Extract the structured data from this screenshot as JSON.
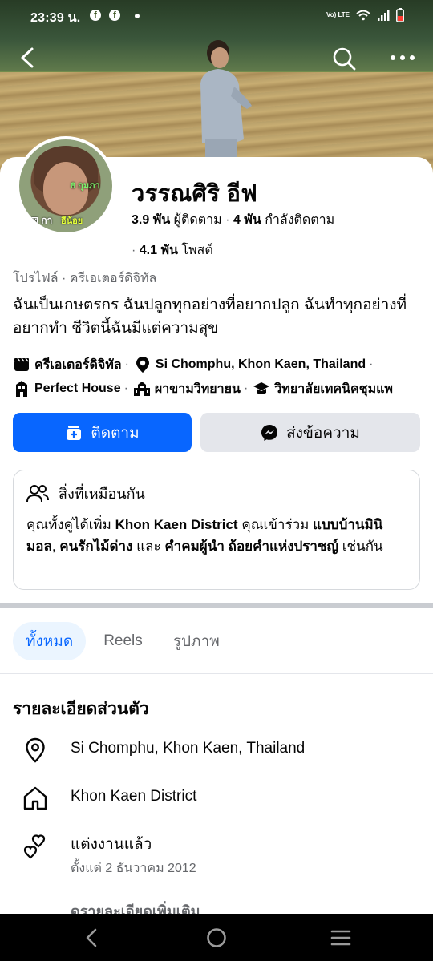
{
  "status_bar": {
    "time": "23:39 น.",
    "network": "Vo) LTE"
  },
  "profile": {
    "name": "วรรณศิริ อีฟ",
    "followers_count": "3.9 พัน",
    "followers_label": "ผู้ติดตาม",
    "following_count": "4 พัน",
    "following_label": "กำลังติดตาม",
    "posts_count": "4.1 พัน",
    "posts_label": "โพสต์",
    "category": "โปรไฟล์ · ครีเอเตอร์ดิจิทัล",
    "bio": "ฉันเป็นเกษตรกร ฉันปลูกทุกอย่างที่อยากปลูก ฉันทำทุกอย่างที่อยากทำ ชีวิตนี้ฉันมีแต่ความสุข",
    "avatar_overlay": {
      "top": "8 กุมภา",
      "bottom_left": "⊠ กา",
      "bottom_right": "อีน้อย"
    }
  },
  "details": {
    "creator": "ครีเอเตอร์ดิจิทัล",
    "location": "Si Chomphu, Khon Kaen, Thailand",
    "workplace": "Perfect House",
    "college": "ผาขามวิทยายน",
    "school": "วิทยาลัยเทคนิคชุมแพ"
  },
  "buttons": {
    "follow": "ติดตาม",
    "message": "ส่งข้อความ"
  },
  "in_common": {
    "title": "สิ่งที่เหมือนกัน",
    "t1": "คุณทั้งคู่ได้เพิ่ม ",
    "b1": "Khon Kaen District",
    "t2": " คุณเข้าร่วม ",
    "b2": "แบบบ้านมินิมอล",
    "t3": ", ",
    "b3": "คนรักไม้ด่าง",
    "t4": " และ ",
    "b4": "คำคมผู้นำ ถ้อยคำแห่งปราชญ์",
    "t5": " เช่นกัน"
  },
  "tabs": [
    "ทั้งหมด",
    "Reels",
    "รูปภาพ"
  ],
  "personal_details": {
    "title": "รายละเอียดส่วนตัว",
    "location": "Si Chomphu, Khon Kaen, Thailand",
    "hometown": "Khon Kaen District",
    "relationship": "แต่งงานแล้ว",
    "relationship_since": "ตั้งแต่ 2 ธันวาคม  2012",
    "more": "ดรายละเอียดเพิ่มเติม"
  },
  "colors": {
    "primary": "#0866ff",
    "secondary_bg": "#e4e6eb",
    "muted_text": "#65676b"
  },
  "icons": [
    "back-icon",
    "search-icon",
    "more-icon",
    "follow-icon",
    "messenger-icon",
    "mutual-icon",
    "location-pin-icon",
    "home-icon",
    "hearts-icon"
  ]
}
